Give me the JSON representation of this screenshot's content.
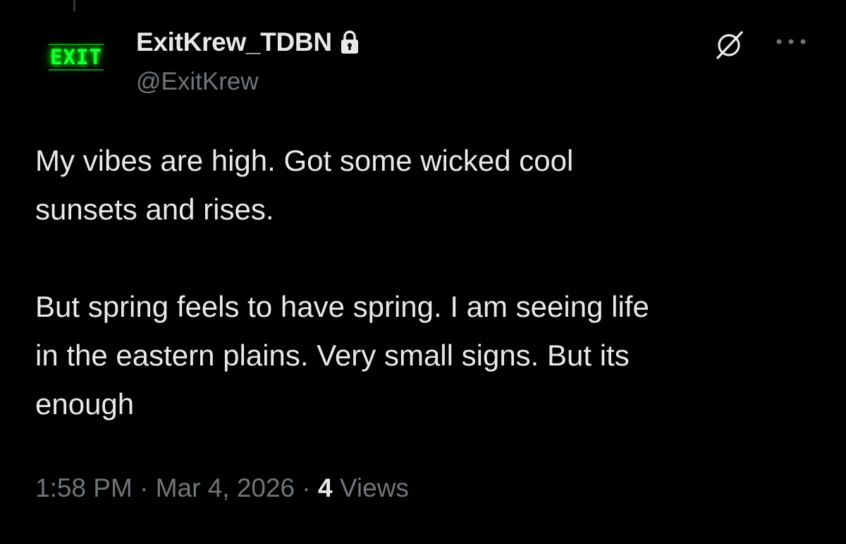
{
  "author": {
    "avatar_text": "EXIT",
    "display_name": "ExitKrew_TDBN",
    "handle": "@ExitKrew",
    "icons": {
      "lock": "lock-icon",
      "grok": "grok-icon",
      "more": "more-options-icon"
    }
  },
  "tweet": {
    "text": "My vibes are high. Got some wicked cool\nsunsets and rises.\n\nBut spring feels to have spring. I am seeing life\nin the eastern plains. Very small signs. But its\nenough"
  },
  "meta": {
    "time": "1:58 PM",
    "separator": "·",
    "date": "Mar 4, 2026",
    "views_count": "4",
    "views_label": "Views"
  },
  "colors": {
    "background": "#000000",
    "primary_text": "#e7e9ea",
    "secondary_text": "#71767b",
    "avatar_neon": "#1aff3c"
  }
}
